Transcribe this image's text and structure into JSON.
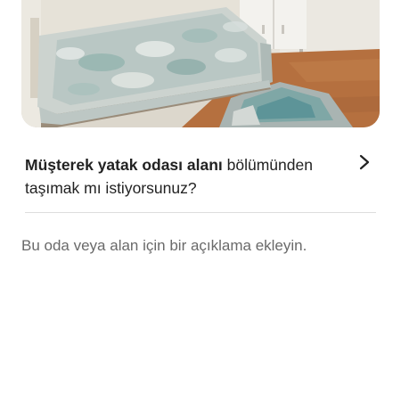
{
  "photo": {
    "alt_icon": "room-photo"
  },
  "move_section": {
    "space_name": "Müşterek yatak odası alanı",
    "question_rest": " bölümünden taşımak mı istiyorsunuz?",
    "chevron_icon": "chevron-right-icon"
  },
  "description": {
    "placeholder": "Bu oda veya alan için bir açıklama ekleyin."
  },
  "colors": {
    "text_primary": "#222222",
    "text_secondary": "#6a6a6a",
    "divider": "#dddddd"
  }
}
